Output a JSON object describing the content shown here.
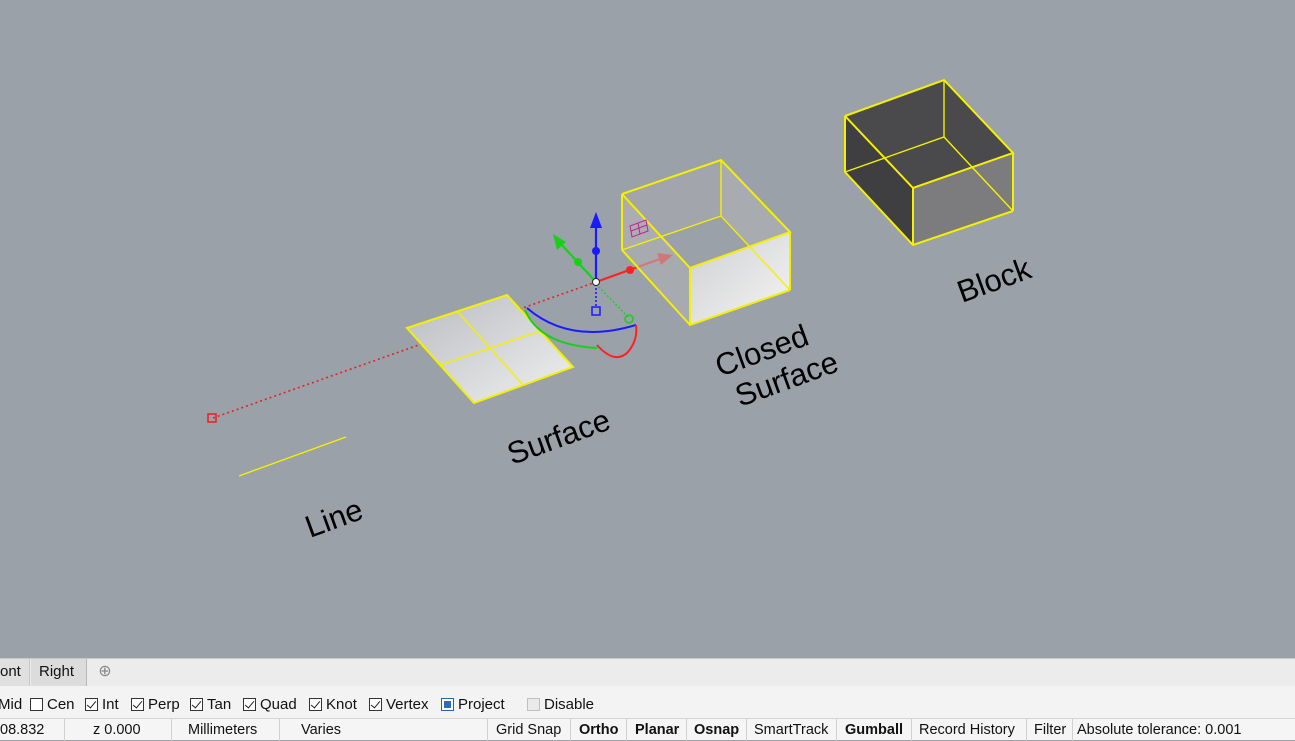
{
  "viewport": {
    "labels": {
      "line": "Line",
      "surface": "Surface",
      "closed_surface_1": "Closed",
      "closed_surface_2": "Surface",
      "block": "Block"
    },
    "colors": {
      "background": "#9aa1a9",
      "selection": "#ffff00",
      "gumball_x": "#ff2020",
      "gumball_y": "#20d020",
      "gumball_z": "#2020ff"
    }
  },
  "tabs": {
    "items": [
      {
        "label": "ont"
      },
      {
        "label": "Right"
      }
    ],
    "add_icon": "plus-icon"
  },
  "osnap": {
    "items": [
      {
        "label": "Mid",
        "state": "checked-partial"
      },
      {
        "label": "Cen",
        "state": "unchecked"
      },
      {
        "label": "Int",
        "state": "checked"
      },
      {
        "label": "Perp",
        "state": "checked"
      },
      {
        "label": "Tan",
        "state": "checked"
      },
      {
        "label": "Quad",
        "state": "checked"
      },
      {
        "label": "Knot",
        "state": "checked"
      },
      {
        "label": "Vertex",
        "state": "checked"
      },
      {
        "label": "Project",
        "state": "filled"
      },
      {
        "label": "Disable",
        "state": "disabled"
      }
    ]
  },
  "status": {
    "x": "08.832",
    "z": "z 0.000",
    "units": "Millimeters",
    "layer": "Varies",
    "grid_snap": "Grid Snap",
    "ortho": "Ortho",
    "planar": "Planar",
    "osnap": "Osnap",
    "smarttrack": "SmartTrack",
    "gumball": "Gumball",
    "record_history": "Record History",
    "filter": "Filter",
    "tolerance": "Absolute tolerance: 0.001"
  }
}
